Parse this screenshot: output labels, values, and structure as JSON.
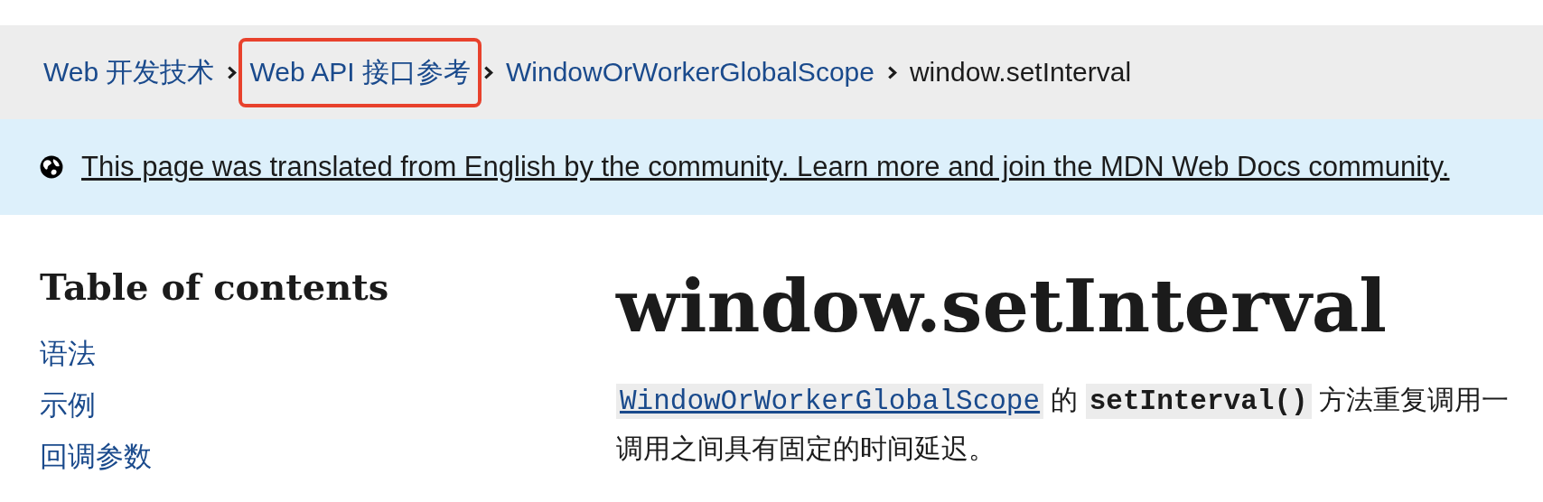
{
  "breadcrumbs": [
    {
      "label": "Web 开发技术",
      "link": true,
      "highlighted": false
    },
    {
      "label": "Web API 接口参考",
      "link": true,
      "highlighted": true
    },
    {
      "label": "WindowOrWorkerGlobalScope",
      "link": true,
      "highlighted": false
    },
    {
      "label": "window.setInterval",
      "link": false,
      "highlighted": false
    }
  ],
  "banner": {
    "text": "This page was translated from English by the community. Learn more and join the MDN Web Docs community."
  },
  "toc": {
    "title": "Table of contents",
    "items": [
      "语法",
      "示例",
      "回调参数"
    ]
  },
  "article": {
    "title": "window.setInterval",
    "intro": {
      "link": "WindowOrWorkerGlobalScope",
      "text_1": "的",
      "code": "setInterval()",
      "text_2": "方法重复调用一",
      "line_2": "调用之间具有固定的时间延迟。"
    }
  }
}
